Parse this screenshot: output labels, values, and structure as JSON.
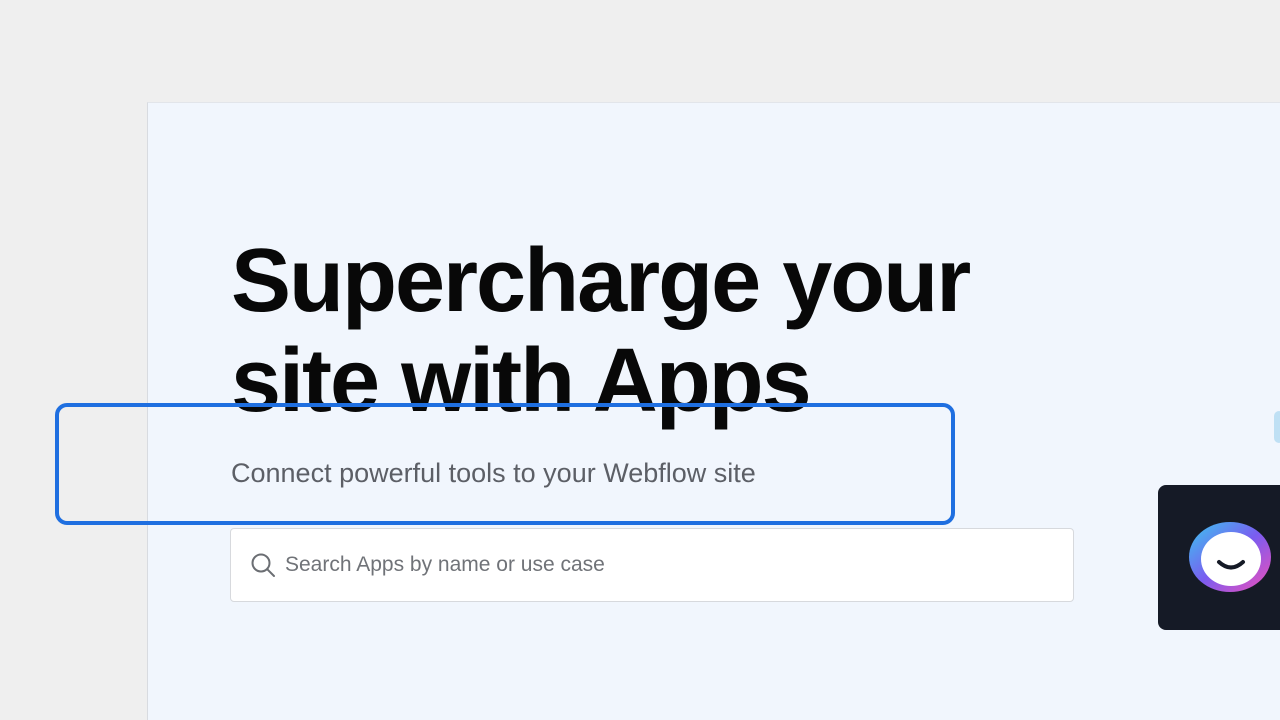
{
  "hero": {
    "headline": "Supercharge your site with Apps",
    "subtitle": "Connect powerful tools to your Webflow site"
  },
  "search": {
    "icon": "search-icon",
    "placeholder": "Search Apps by name or use case",
    "value": ""
  },
  "chat_widget": {
    "icon": "assistant-face-icon"
  },
  "colors": {
    "page_background": "#f1f6fd",
    "outer_background": "#efefef",
    "focus_ring": "#1f6fe0",
    "headline_text": "#080808",
    "subtitle_text": "#5c5f66",
    "widget_background": "#151a26"
  }
}
